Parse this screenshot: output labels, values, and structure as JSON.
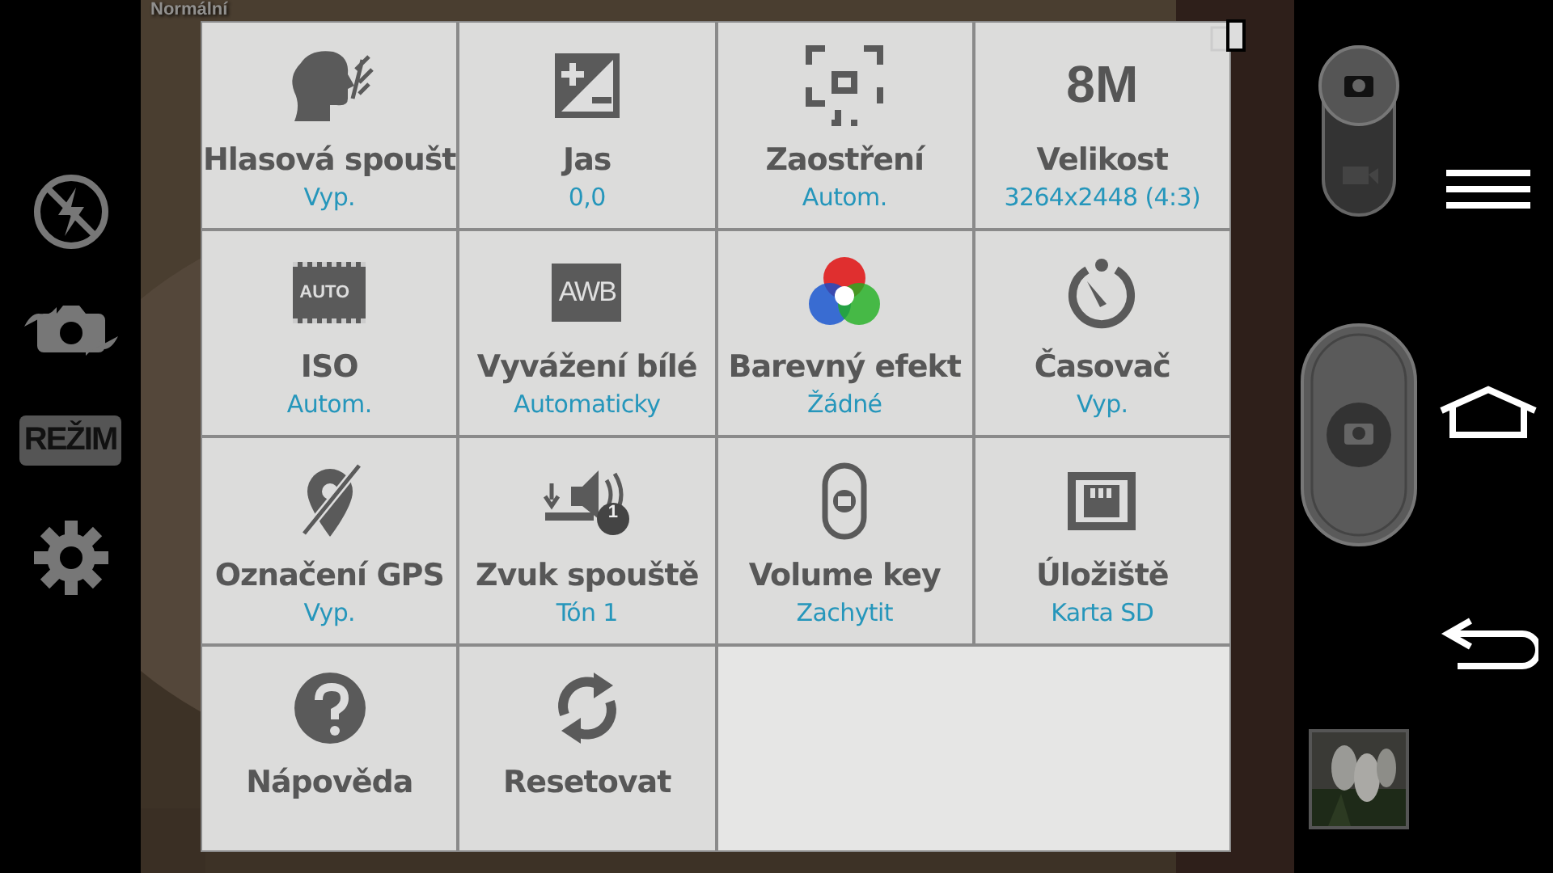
{
  "sidebar": {
    "items": [
      {
        "kind": "flash"
      },
      {
        "kind": "switch"
      },
      {
        "kind": "mode",
        "label": "REŽIM"
      },
      {
        "kind": "settings"
      }
    ]
  },
  "viewfinder": {
    "mode_label": "Normální",
    "kind": "picture"
  },
  "settings_grid": {
    "items": [
      {
        "kind": "voice",
        "title": "Hlasová spoušt",
        "value": "Vyp."
      },
      {
        "kind": "exposure",
        "title": "Jas",
        "value": "0,0"
      },
      {
        "kind": "focus",
        "title": "Zaostření",
        "value": "Autom."
      },
      {
        "kind": "size",
        "icon_text": "8M",
        "title": "Velikost",
        "value": "3264x2448 (4:3)"
      },
      {
        "kind": "iso",
        "icon_text": "AUTO",
        "title": "ISO",
        "value": "Autom."
      },
      {
        "kind": "wb",
        "icon_text": "AWB",
        "title": "Vyvážení bílé",
        "value": "Automaticky"
      },
      {
        "kind": "color",
        "title": "Barevný efekt",
        "value": "Žádné"
      },
      {
        "kind": "timer",
        "title": "Časovač",
        "value": "Vyp."
      },
      {
        "kind": "gps",
        "title": "Označení GPS",
        "value": "Vyp."
      },
      {
        "kind": "sound",
        "icon_text": "1",
        "title": "Zvuk spouště",
        "value": "Tón 1"
      },
      {
        "kind": "volume",
        "title": "Volume key",
        "value": "Zachytit"
      },
      {
        "kind": "storage",
        "title": "Úložiště",
        "value": "Karta SD"
      },
      {
        "kind": "help",
        "title": "Nápověda"
      },
      {
        "kind": "reset",
        "title": "Resetovat"
      }
    ]
  },
  "camera_controls": {
    "photo_selected": true
  },
  "nav": {
    "buttons": [
      {
        "kind": "menu"
      },
      {
        "kind": "home"
      },
      {
        "kind": "back"
      }
    ]
  }
}
